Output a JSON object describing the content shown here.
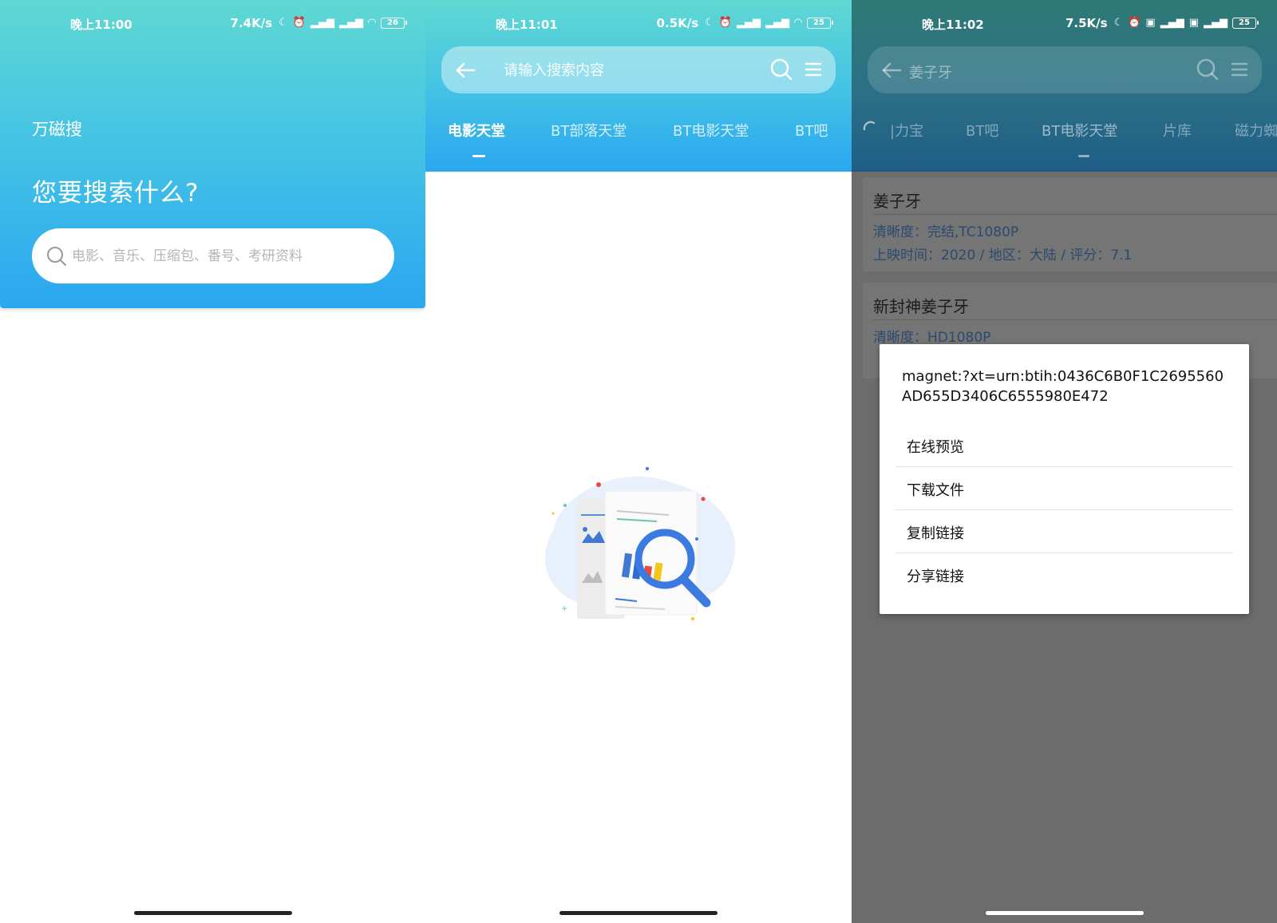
{
  "screen1": {
    "status": {
      "time": "晚上11:00",
      "speed": "7.4K/s",
      "battery": "26"
    },
    "app_title": "万磁搜",
    "heading": "您要搜索什么?",
    "search_placeholder": "电影、音乐、压缩包、番号、考研资料"
  },
  "screen2": {
    "status": {
      "time": "晚上11:01",
      "speed": "0.5K/s",
      "battery": "25"
    },
    "search_placeholder": "请输入搜索内容",
    "tabs": [
      {
        "label": "电影天堂",
        "active": true
      },
      {
        "label": "BT部落天堂",
        "active": false
      },
      {
        "label": "BT电影天堂",
        "active": false
      },
      {
        "label": "BT吧",
        "active": false
      }
    ],
    "empty_state_icon": "document-search-illustration"
  },
  "screen3": {
    "status": {
      "time": "晚上11:02",
      "speed": "7.5K/s",
      "battery": "25"
    },
    "query": "姜子牙",
    "tabs": [
      {
        "label": "|力宝",
        "active": false
      },
      {
        "label": "BT吧",
        "active": false
      },
      {
        "label": "BT电影天堂",
        "active": true
      },
      {
        "label": "片库",
        "active": false
      },
      {
        "label": "磁力蜘",
        "active": false
      }
    ],
    "results": [
      {
        "title": "姜子牙",
        "meta1": "清晰度：完结,TC1080P",
        "meta2": "上映时间：2020 / 地区：大陆 / 评分：7.1"
      },
      {
        "title": "新封神姜子牙",
        "meta1": "清晰度：HD1080P"
      }
    ],
    "dialog": {
      "magnet": "magnet:?xt=urn:btih:0436C6B0F1C2695560AD655D3406C6555980E472",
      "items": [
        "在线预览",
        "下载文件",
        "复制链接",
        "分享链接"
      ]
    }
  },
  "colors": {
    "gradient_top": "#5fd8d2",
    "gradient_bottom": "#2aa7f0",
    "dim_overlay": "#6c6c6c"
  }
}
